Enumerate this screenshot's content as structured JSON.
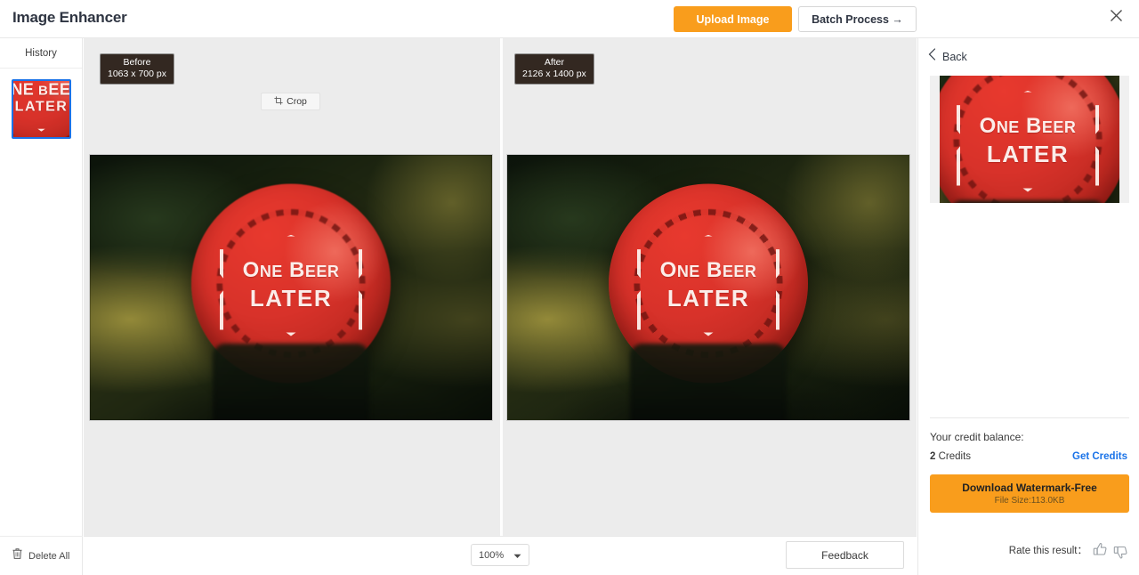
{
  "header": {
    "app_title": "Image Enhancer",
    "upload_label": "Upload Image",
    "batch_label": "Batch Process →",
    "close_icon": "close-icon"
  },
  "sidebar": {
    "history_label": "History",
    "thumbnail_alt": "bottle-cap-thumbnail",
    "delete_all_label": "Delete All",
    "trash_icon": "trash-icon"
  },
  "canvas": {
    "before": {
      "title": "Before",
      "dimensions": "1063 x 700 px"
    },
    "after": {
      "title": "After",
      "dimensions": "2126 x 1400 px"
    },
    "crop_label": "Crop",
    "crop_icon": "crop-icon"
  },
  "image": {
    "cap_line1_first": "O",
    "cap_line1": "NE ",
    "cap_line1_b": "B",
    "cap_line1_c": "EER",
    "cap_line2": "LATER"
  },
  "bottombar": {
    "zoom_value": "100%",
    "zoom_chevron_icon": "chevron-down-icon",
    "feedback_label": "Feedback"
  },
  "rightpanel": {
    "back_label": "Back",
    "back_icon": "chevron-left-icon",
    "credit_label": "Your credit balance:",
    "credit_count": "2",
    "credit_unit": " Credits",
    "get_credits_label": "Get Credits",
    "download_title": "Download Watermark-Free",
    "download_subtitle": "File Size:113.0KB",
    "rate_label": "Rate this result：",
    "thumbs_up_icon": "thumbs-up-icon",
    "thumbs_down_icon": "thumbs-down-icon"
  },
  "colors": {
    "accent_orange": "#f99d1c",
    "link_blue": "#1a73e8",
    "selection_blue": "#1a73e8",
    "badge_dark": "#332821",
    "canvas_gray": "#ececec"
  }
}
